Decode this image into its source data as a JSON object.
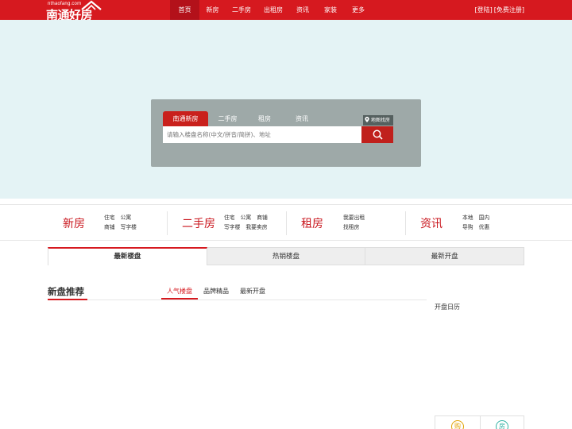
{
  "header": {
    "logo_site": "nthaofang.com",
    "logo_name": "南通好房",
    "nav": [
      "首页",
      "新房",
      "二手房",
      "出租房",
      "资讯",
      "家装",
      "更多"
    ],
    "active_nav": "首页",
    "login": "[登陆]",
    "register": "[免费注册]"
  },
  "search": {
    "tabs": [
      "南通新房",
      "二手房",
      "租房",
      "资讯"
    ],
    "active_tab": "南通新房",
    "map_link": "地图找房",
    "placeholder": "请输入楼盘名称(中文/拼音/简拼)、地址"
  },
  "categories": [
    {
      "title": "新房",
      "links": [
        "住宅",
        "公寓",
        "商铺",
        "写字楼"
      ]
    },
    {
      "title": "二手房",
      "links": [
        "住宅",
        "公寓",
        "商铺",
        "写字楼",
        "我要卖房"
      ]
    },
    {
      "title": "租房",
      "links": [
        "我要出租",
        "找租房"
      ]
    },
    {
      "title": "资讯",
      "links": [
        "本地",
        "国内",
        "导购",
        "优惠"
      ]
    }
  ],
  "listing_tabs": [
    "最新楼盘",
    "热销楼盘",
    "最新开盘"
  ],
  "active_listing_tab": "最新楼盘",
  "recommend": {
    "title": "新盘推荐",
    "tabs": [
      "人气楼盘",
      "品牌精品",
      "最新开盘"
    ],
    "active_tab": "人气楼盘",
    "calendar": "开盘日历"
  },
  "side_icons": {
    "buy": "购",
    "house": "房"
  },
  "colors": {
    "brand_red": "#d6191f",
    "banner_bg": "#e4f3f5",
    "search_panel": "#9ea9a8"
  }
}
